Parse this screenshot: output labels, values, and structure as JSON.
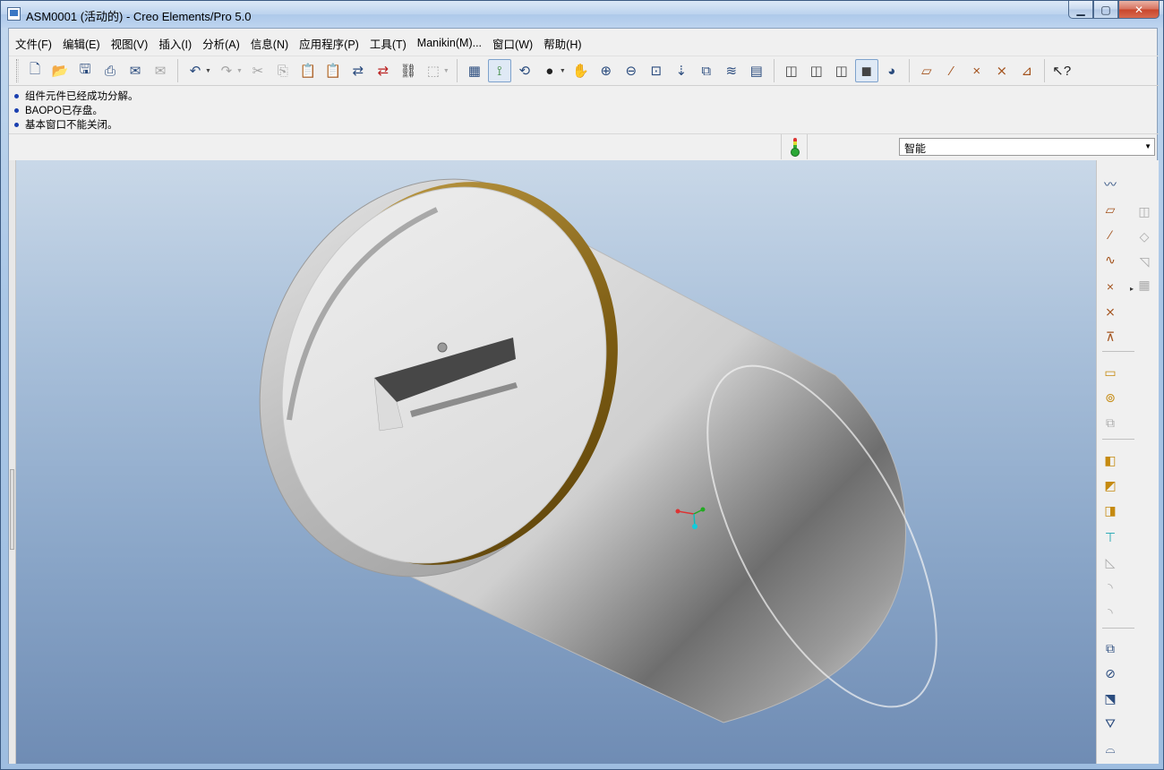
{
  "window": {
    "title": "ASM0001 (活动的) - Creo Elements/Pro 5.0",
    "buttons": {
      "minimize": "▁",
      "maximize": "▢",
      "close": "✕"
    }
  },
  "menu": [
    "文件(F)",
    "编辑(E)",
    "视图(V)",
    "插入(I)",
    "分析(A)",
    "信息(N)",
    "应用程序(P)",
    "工具(T)",
    "Manikin(M)...",
    "窗口(W)",
    "帮助(H)"
  ],
  "toolbar": {
    "file": [
      "new-file-icon",
      "open-folder-icon",
      "save-icon",
      "print-icon",
      "send-mail-icon",
      "send-mail-disabled-icon"
    ],
    "edit": [
      "undo-icon",
      "redo-icon",
      "cut-icon",
      "copy-icon",
      "paste-icon",
      "paste-special-icon",
      "regenerate-icon",
      "regen-manager-icon",
      "find-icon",
      "select-box-icon"
    ],
    "view": [
      "repaint-icon",
      "spin-center-icon",
      "orient-mode-icon",
      "appearance-icon",
      "pan-icon",
      "zoom-in-icon",
      "zoom-out-icon",
      "refit-icon",
      "reorient-icon",
      "saved-views-icon",
      "layers-icon",
      "view-manager-icon"
    ],
    "display": [
      "wireframe-icon",
      "hidden-line-icon",
      "no-hidden-icon",
      "shading-icon",
      "enhanced-realism-icon"
    ],
    "datum": [
      "datum-planes-icon",
      "datum-axes-icon",
      "datum-points-icon",
      "csys-icon",
      "annotations-icon"
    ],
    "help": [
      "context-help-icon"
    ]
  },
  "messages": [
    "组件元件已经成功分解。",
    "BAOPO已存盘。",
    "基本窗口不能关闭。"
  ],
  "filter": {
    "value": "智能"
  },
  "right_toolbar": {
    "datum": [
      "sketched-curve-icon",
      "datum-plane-icon",
      "datum-axis-icon",
      "datum-curve-icon",
      "datum-point-icon",
      "coordinate-system-icon",
      "analysis-feature-icon"
    ],
    "component": [
      "add-component-icon",
      "create-component-icon",
      "package-component-icon"
    ],
    "features": [
      "extrude-icon",
      "revolve-icon",
      "sweep-icon",
      "hole-icon",
      "round-icon",
      "chamfer-icon",
      "draft-icon"
    ],
    "bottom": [
      "pattern-icon",
      "mirror-icon",
      "merge-icon",
      "trim-icon",
      "boundary-icon"
    ],
    "side": [
      "mirror-tool-icon",
      "copy-tool-icon",
      "mirror-small-icon",
      "table-icon"
    ]
  },
  "model": {
    "description": "cylinder-assembly",
    "cap_color": "#e2e2e2",
    "body_color": "#cfcfcf",
    "rim_color": "#8b6a1e"
  }
}
